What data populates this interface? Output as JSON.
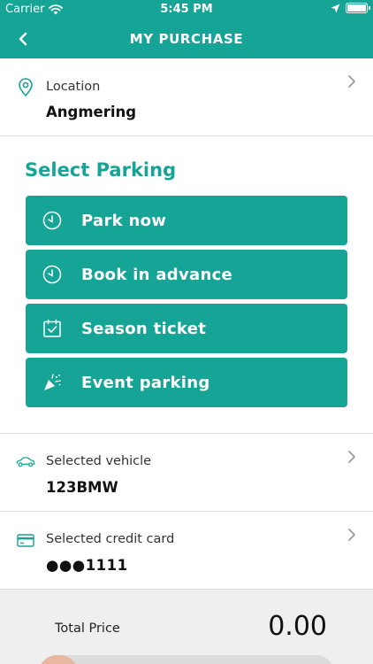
{
  "status_bar": {
    "carrier": "Carrier",
    "time": "5:45 PM"
  },
  "nav": {
    "title": "MY PURCHASE",
    "back_icon": "chevron-left-icon"
  },
  "location": {
    "label": "Location",
    "value": "Angmering",
    "icon": "map-pin-icon"
  },
  "select_parking": {
    "title": "Select Parking",
    "options": [
      {
        "label": "Park now",
        "icon": "clock-icon"
      },
      {
        "label": "Book in advance",
        "icon": "clock-icon"
      },
      {
        "label": "Season ticket",
        "icon": "calendar-check-icon"
      },
      {
        "label": "Event parking",
        "icon": "party-popper-icon"
      }
    ]
  },
  "vehicle": {
    "label": "Selected vehicle",
    "value": "123BMW",
    "icon": "car-icon"
  },
  "credit_card": {
    "label": "Selected credit card",
    "value": "●●●1111",
    "icon": "credit-card-icon"
  },
  "total": {
    "label": "Total Price",
    "value": "0.00"
  },
  "colors": {
    "accent": "#16a496",
    "divider": "#dcdcdc",
    "footer_bg": "#efefef"
  }
}
